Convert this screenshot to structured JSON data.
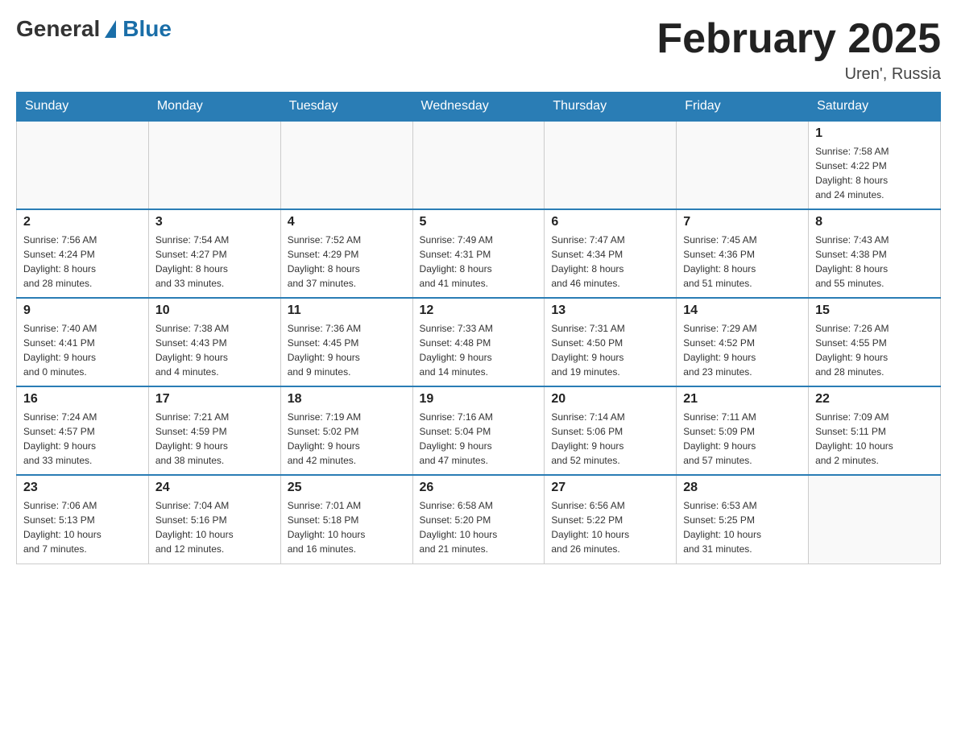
{
  "header": {
    "logo_general": "General",
    "logo_blue": "Blue",
    "title": "February 2025",
    "location": "Uren', Russia"
  },
  "days_of_week": [
    "Sunday",
    "Monday",
    "Tuesday",
    "Wednesday",
    "Thursday",
    "Friday",
    "Saturday"
  ],
  "weeks": [
    [
      {
        "day": "",
        "info": ""
      },
      {
        "day": "",
        "info": ""
      },
      {
        "day": "",
        "info": ""
      },
      {
        "day": "",
        "info": ""
      },
      {
        "day": "",
        "info": ""
      },
      {
        "day": "",
        "info": ""
      },
      {
        "day": "1",
        "info": "Sunrise: 7:58 AM\nSunset: 4:22 PM\nDaylight: 8 hours\nand 24 minutes."
      }
    ],
    [
      {
        "day": "2",
        "info": "Sunrise: 7:56 AM\nSunset: 4:24 PM\nDaylight: 8 hours\nand 28 minutes."
      },
      {
        "day": "3",
        "info": "Sunrise: 7:54 AM\nSunset: 4:27 PM\nDaylight: 8 hours\nand 33 minutes."
      },
      {
        "day": "4",
        "info": "Sunrise: 7:52 AM\nSunset: 4:29 PM\nDaylight: 8 hours\nand 37 minutes."
      },
      {
        "day": "5",
        "info": "Sunrise: 7:49 AM\nSunset: 4:31 PM\nDaylight: 8 hours\nand 41 minutes."
      },
      {
        "day": "6",
        "info": "Sunrise: 7:47 AM\nSunset: 4:34 PM\nDaylight: 8 hours\nand 46 minutes."
      },
      {
        "day": "7",
        "info": "Sunrise: 7:45 AM\nSunset: 4:36 PM\nDaylight: 8 hours\nand 51 minutes."
      },
      {
        "day": "8",
        "info": "Sunrise: 7:43 AM\nSunset: 4:38 PM\nDaylight: 8 hours\nand 55 minutes."
      }
    ],
    [
      {
        "day": "9",
        "info": "Sunrise: 7:40 AM\nSunset: 4:41 PM\nDaylight: 9 hours\nand 0 minutes."
      },
      {
        "day": "10",
        "info": "Sunrise: 7:38 AM\nSunset: 4:43 PM\nDaylight: 9 hours\nand 4 minutes."
      },
      {
        "day": "11",
        "info": "Sunrise: 7:36 AM\nSunset: 4:45 PM\nDaylight: 9 hours\nand 9 minutes."
      },
      {
        "day": "12",
        "info": "Sunrise: 7:33 AM\nSunset: 4:48 PM\nDaylight: 9 hours\nand 14 minutes."
      },
      {
        "day": "13",
        "info": "Sunrise: 7:31 AM\nSunset: 4:50 PM\nDaylight: 9 hours\nand 19 minutes."
      },
      {
        "day": "14",
        "info": "Sunrise: 7:29 AM\nSunset: 4:52 PM\nDaylight: 9 hours\nand 23 minutes."
      },
      {
        "day": "15",
        "info": "Sunrise: 7:26 AM\nSunset: 4:55 PM\nDaylight: 9 hours\nand 28 minutes."
      }
    ],
    [
      {
        "day": "16",
        "info": "Sunrise: 7:24 AM\nSunset: 4:57 PM\nDaylight: 9 hours\nand 33 minutes."
      },
      {
        "day": "17",
        "info": "Sunrise: 7:21 AM\nSunset: 4:59 PM\nDaylight: 9 hours\nand 38 minutes."
      },
      {
        "day": "18",
        "info": "Sunrise: 7:19 AM\nSunset: 5:02 PM\nDaylight: 9 hours\nand 42 minutes."
      },
      {
        "day": "19",
        "info": "Sunrise: 7:16 AM\nSunset: 5:04 PM\nDaylight: 9 hours\nand 47 minutes."
      },
      {
        "day": "20",
        "info": "Sunrise: 7:14 AM\nSunset: 5:06 PM\nDaylight: 9 hours\nand 52 minutes."
      },
      {
        "day": "21",
        "info": "Sunrise: 7:11 AM\nSunset: 5:09 PM\nDaylight: 9 hours\nand 57 minutes."
      },
      {
        "day": "22",
        "info": "Sunrise: 7:09 AM\nSunset: 5:11 PM\nDaylight: 10 hours\nand 2 minutes."
      }
    ],
    [
      {
        "day": "23",
        "info": "Sunrise: 7:06 AM\nSunset: 5:13 PM\nDaylight: 10 hours\nand 7 minutes."
      },
      {
        "day": "24",
        "info": "Sunrise: 7:04 AM\nSunset: 5:16 PM\nDaylight: 10 hours\nand 12 minutes."
      },
      {
        "day": "25",
        "info": "Sunrise: 7:01 AM\nSunset: 5:18 PM\nDaylight: 10 hours\nand 16 minutes."
      },
      {
        "day": "26",
        "info": "Sunrise: 6:58 AM\nSunset: 5:20 PM\nDaylight: 10 hours\nand 21 minutes."
      },
      {
        "day": "27",
        "info": "Sunrise: 6:56 AM\nSunset: 5:22 PM\nDaylight: 10 hours\nand 26 minutes."
      },
      {
        "day": "28",
        "info": "Sunrise: 6:53 AM\nSunset: 5:25 PM\nDaylight: 10 hours\nand 31 minutes."
      },
      {
        "day": "",
        "info": ""
      }
    ]
  ]
}
